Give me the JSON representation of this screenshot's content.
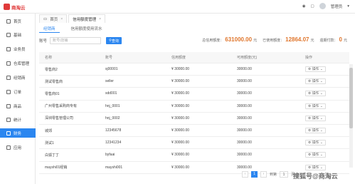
{
  "header": {
    "logo_text": "商淘云",
    "user": "管理员"
  },
  "sidebar": {
    "items": [
      {
        "label": "首页"
      },
      {
        "label": "基础"
      },
      {
        "label": "业务员"
      },
      {
        "label": "仓库管理"
      },
      {
        "label": "经销商"
      },
      {
        "label": "订单"
      },
      {
        "label": "商品"
      },
      {
        "label": "统计"
      },
      {
        "label": "财务"
      },
      {
        "label": "应用"
      }
    ]
  },
  "tabs": [
    {
      "label": "首页"
    },
    {
      "label": "信用额度管理"
    }
  ],
  "subtabs": [
    {
      "label": "经销商"
    },
    {
      "label": "信用额度使用流水"
    }
  ],
  "search": {
    "label": "账号",
    "placeholder": "账号/店铺",
    "button": "查询"
  },
  "stats": {
    "total_label": "总信用额度：",
    "total_value": "631000.00",
    "total_unit": "元",
    "used_label": "已使用额度：",
    "used_value": "12864.07",
    "used_unit": "元",
    "overdue_label": "逾期付款：",
    "overdue_value": "0",
    "overdue_unit": "元"
  },
  "table": {
    "headers": [
      "名称",
      "账号",
      "信用额度",
      "可用额度(元)",
      "操作"
    ],
    "op_label": "操作",
    "rows": [
      [
        "零售商2",
        "sj00001",
        "¥ 30000.00",
        "30000.00"
      ],
      [
        "测试零售商",
        "seller",
        "¥ 30000.00",
        "30000.00"
      ],
      [
        "零售商01",
        "sdd001",
        "¥ 30000.00",
        "30000.00"
      ],
      [
        "广州零售采购商专有",
        "hnj_0001",
        "¥ 30000.00",
        "30000.00"
      ],
      [
        "深圳零售管理公司",
        "hnj_0002",
        "¥ 30000.00",
        "30000.00"
      ],
      [
        "城郊",
        "12345678",
        "¥ 30000.00",
        "30000.00"
      ],
      [
        "测试1",
        "12341234",
        "¥ 30000.00",
        "30000.00"
      ],
      [
        "白狐丁丁",
        "byfaai",
        "¥ 30000.00",
        "30000.00"
      ],
      [
        "mayshi01经销",
        "mayshi001",
        "¥ 30000.00",
        "30000.00"
      ]
    ]
  },
  "pager": {
    "page": "1",
    "goto_label": "到第",
    "goto_value": "1",
    "page_unit": "页"
  },
  "watermark": "搜狐号@商淘云"
}
